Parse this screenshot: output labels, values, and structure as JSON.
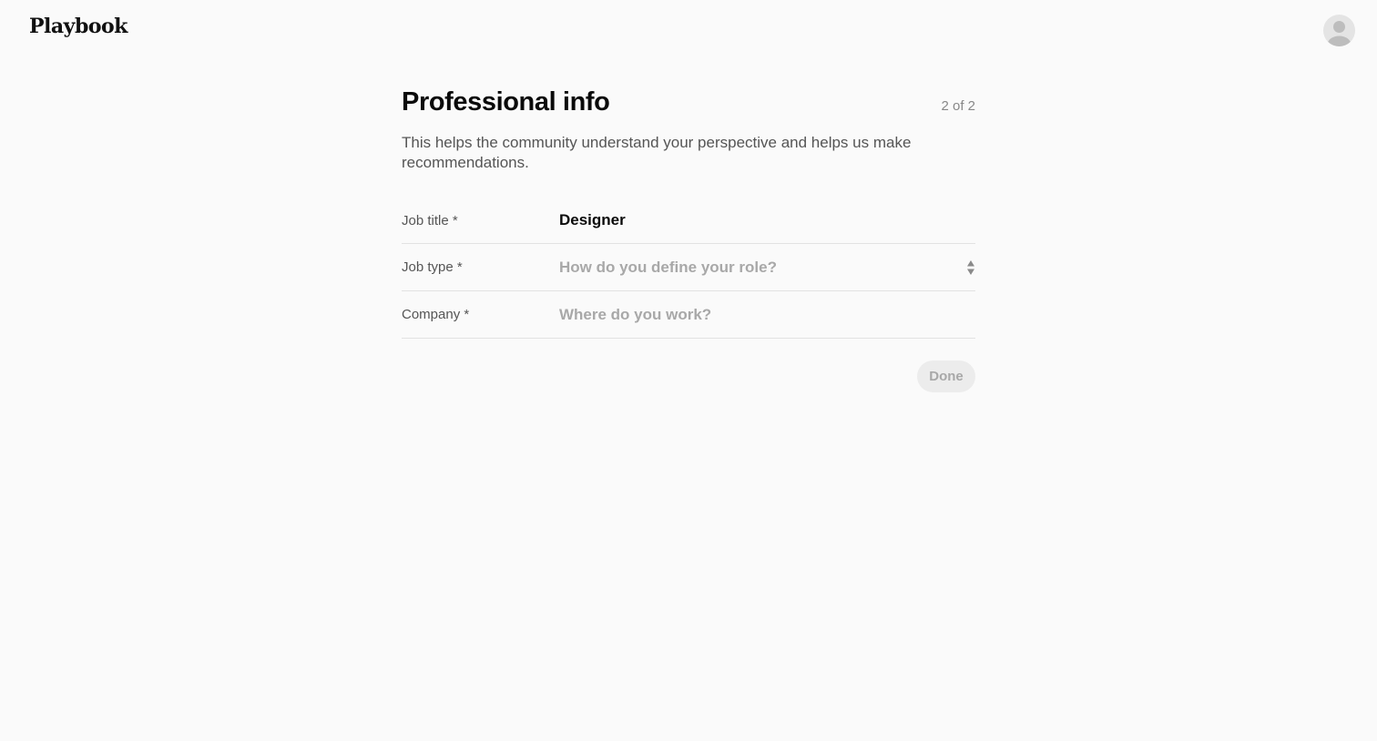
{
  "header": {
    "logo_text": "Playbook",
    "avatar_icon": "user-avatar-icon"
  },
  "page": {
    "title": "Professional info",
    "step": "2 of 2",
    "description": "This helps the community understand your perspective and helps us make recommendations."
  },
  "form": {
    "job_title": {
      "label": "Job title *",
      "value": "Designer"
    },
    "job_type": {
      "label": "Job type *",
      "placeholder": "How do you define your role?",
      "icon": "select-arrows-icon"
    },
    "company": {
      "label": "Company *",
      "placeholder": "Where do you work?"
    }
  },
  "actions": {
    "done_label": "Done"
  },
  "colors": {
    "background": "#fafafa",
    "placeholder": "#a8a8a8",
    "divider": "#e2e2e2",
    "button_disabled_bg": "#ececec"
  }
}
